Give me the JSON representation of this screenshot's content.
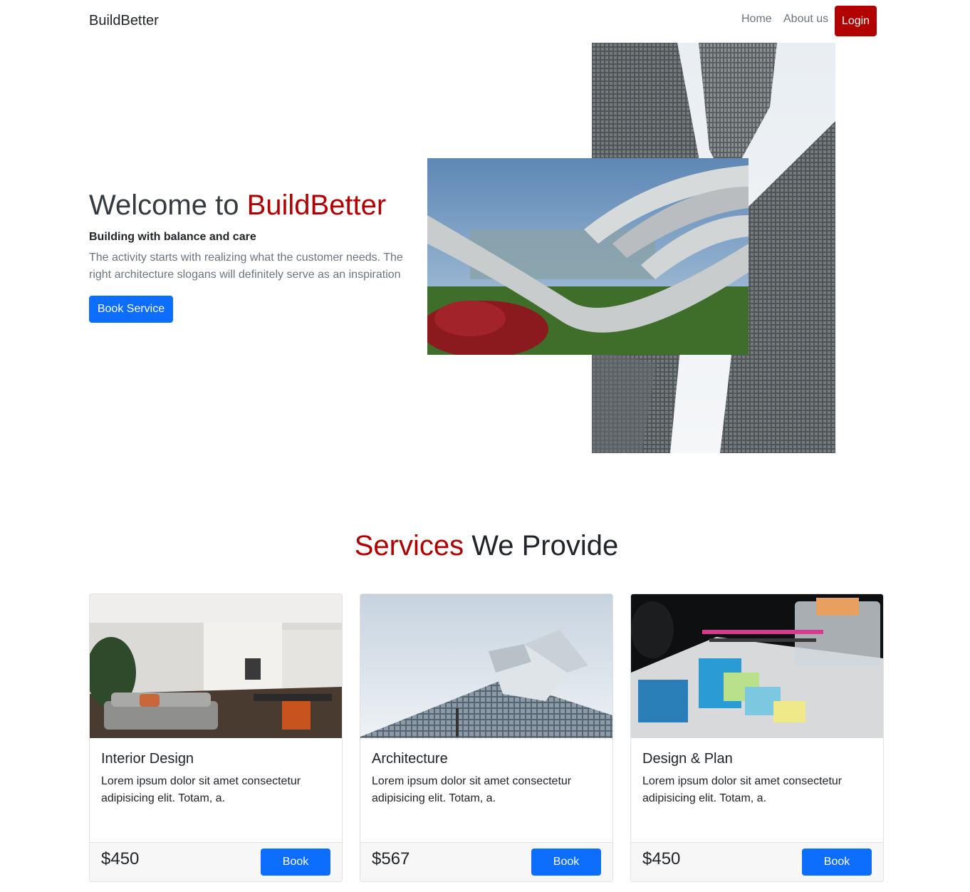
{
  "nav": {
    "brand": "BuildBetter",
    "links": [
      "Home",
      "About us"
    ],
    "login_label": "Login"
  },
  "hero": {
    "title_prefix": "Welcome to ",
    "title_accent": "BuildBetter",
    "subtitle": "Building with balance and care",
    "text": "The activity starts with realizing what the customer needs. The right architecture slogans will definitely serve as an inspiration",
    "button_label": "Book Service"
  },
  "services": {
    "title_accent": "Services",
    "title_rest": " We Provide",
    "cards": [
      {
        "title": "Interior Design",
        "text": "Lorem ipsum dolor sit amet consectetur adipisicing elit. Totam, a.",
        "price": "$450",
        "button_label": "Book"
      },
      {
        "title": "Architecture",
        "text": "Lorem ipsum dolor sit amet consectetur adipisicing elit. Totam, a.",
        "price": "$567",
        "button_label": "Book"
      },
      {
        "title": "Design & Plan",
        "text": "Lorem ipsum dolor sit amet consectetur adipisicing elit. Totam, a.",
        "price": "$450",
        "button_label": "Book"
      }
    ]
  },
  "colors": {
    "accent_red": "#b30000",
    "primary_blue": "#0d6efd",
    "muted_text": "#6c757d"
  }
}
